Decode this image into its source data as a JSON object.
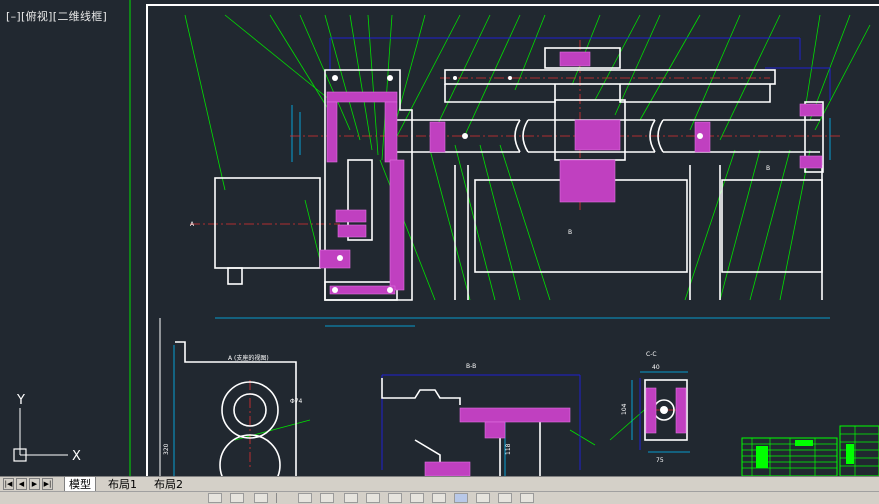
{
  "viewport": {
    "label": "[–][俯视][二维线框]",
    "background": "#212830",
    "colors": {
      "outline": "#ffffff",
      "hatch": "#c040c0",
      "leader": "#00e000",
      "dimension": "#00c0ff",
      "centerline": "#e03030",
      "blue": "#2020d0",
      "table": "#00ff00"
    },
    "annotations": {
      "view_a_title": "A (支座的视图)",
      "section_bb_title": "B-B",
      "section_cc_title": "C-C",
      "arrow_a": "A",
      "arrow_b": "B",
      "dim_phi74": "Φ74",
      "dim_40": "40",
      "dim_104": "104",
      "dim_75": "75",
      "dim_118": "118",
      "dim_320": "320"
    },
    "ucs": {
      "y_label": "Y",
      "x_label": "X"
    }
  },
  "layout_tabs": {
    "items": [
      {
        "label": "模型",
        "active": true
      },
      {
        "label": "布局1",
        "active": false
      },
      {
        "label": "布局2",
        "active": false
      }
    ],
    "nav": [
      "first-icon",
      "prev-icon",
      "next-icon",
      "last-icon"
    ]
  },
  "status_toolbar": {
    "tools": [
      "snap-icon",
      "grid-icon",
      "ortho-icon",
      "polar-icon",
      "osnap-icon",
      "otrack-icon",
      "ducs-icon",
      "dyn-icon",
      "lineweight-icon",
      "transparency-icon",
      "quickprops-icon",
      "selection-cycle-icon"
    ]
  }
}
